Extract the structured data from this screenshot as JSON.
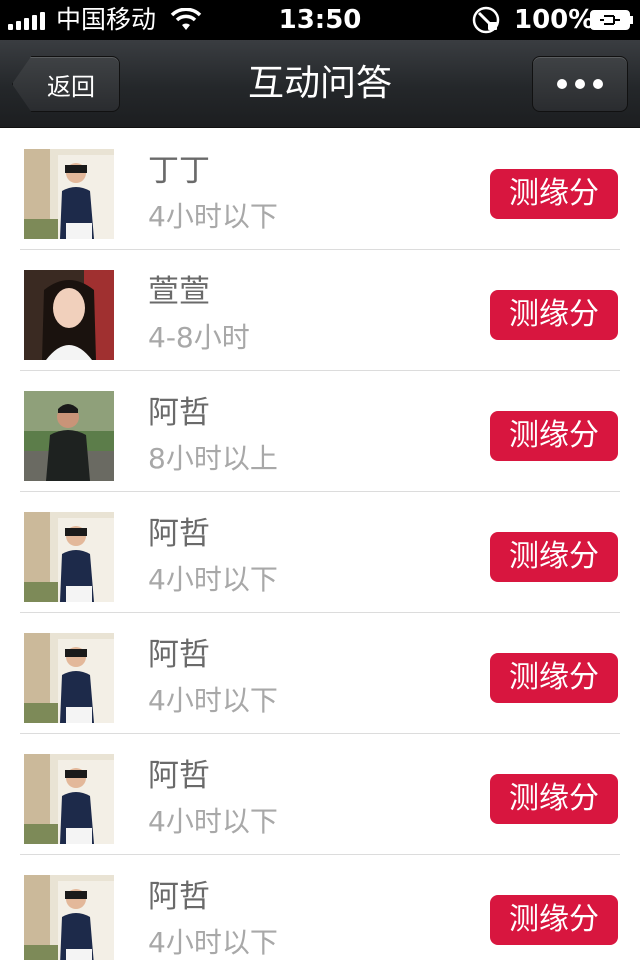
{
  "status_bar": {
    "carrier": "中国移动",
    "time": "13:50",
    "battery": "100%"
  },
  "nav": {
    "back_label": "返回",
    "title": "互动问答",
    "more_icon": "more-dots-icon"
  },
  "colors": {
    "accent": "#d8163f",
    "nav_bg": "#2a2c2f"
  },
  "list": {
    "items": [
      {
        "name": "丁丁",
        "duration": "4小时以下",
        "button": "测缘分",
        "avatar": "man-white-wall"
      },
      {
        "name": "萱萱",
        "duration": "4-8小时",
        "button": "测缘分",
        "avatar": "woman-long-hair"
      },
      {
        "name": "阿哲",
        "duration": "8小时以上",
        "button": "测缘分",
        "avatar": "man-outdoor"
      },
      {
        "name": "阿哲",
        "duration": "4小时以下",
        "button": "测缘分",
        "avatar": "man-white-wall"
      },
      {
        "name": "阿哲",
        "duration": "4小时以下",
        "button": "测缘分",
        "avatar": "man-white-wall"
      },
      {
        "name": "阿哲",
        "duration": "4小时以下",
        "button": "测缘分",
        "avatar": "man-white-wall"
      },
      {
        "name": "阿哲",
        "duration": "4小时以下",
        "button": "测缘分",
        "avatar": "man-white-wall"
      }
    ]
  }
}
